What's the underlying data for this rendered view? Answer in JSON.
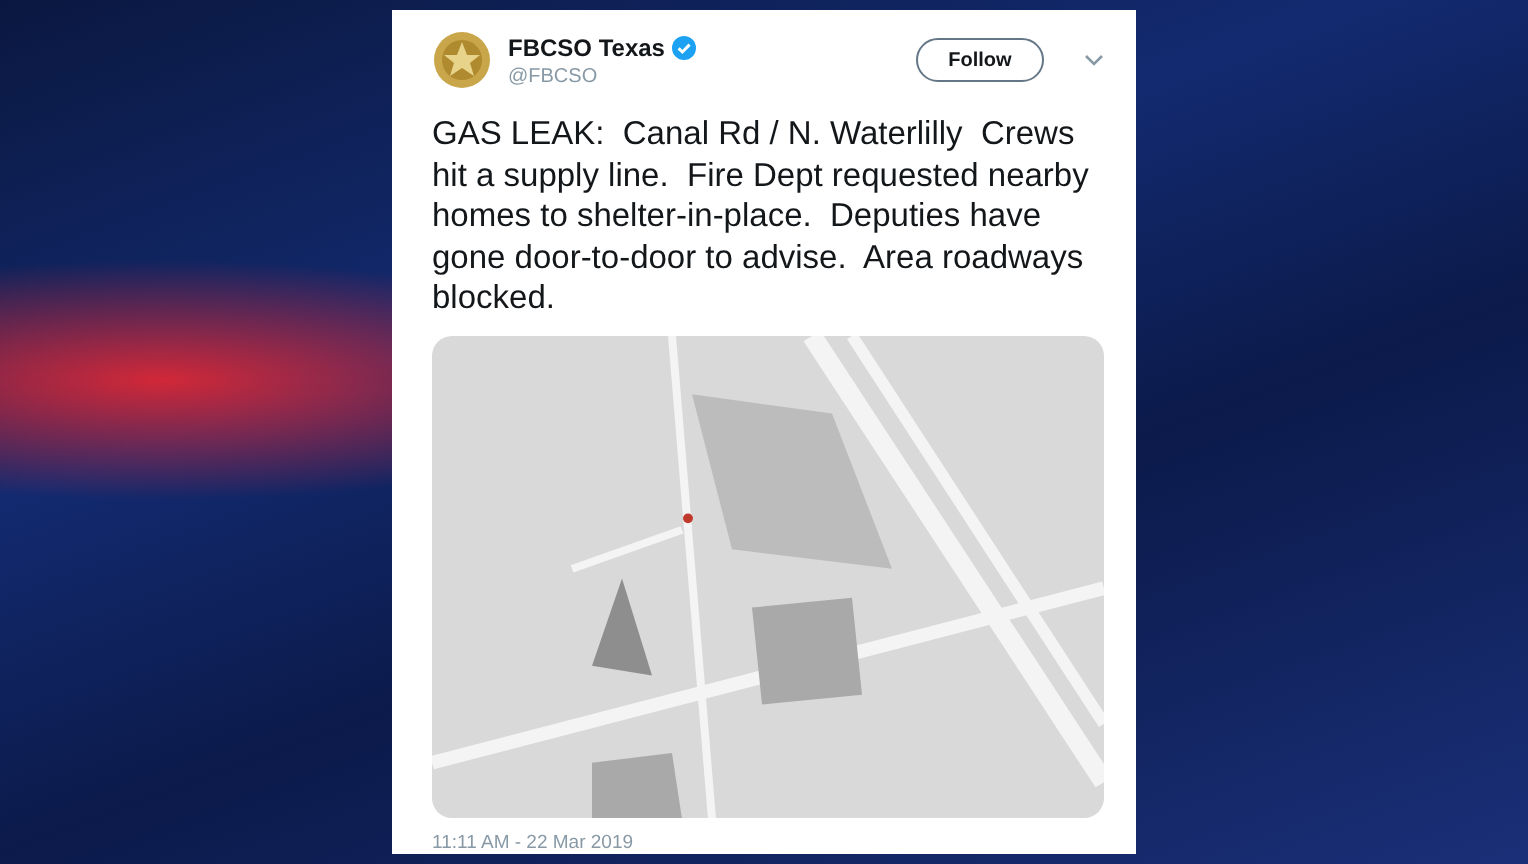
{
  "tweet": {
    "author": "FBCSO Texas",
    "verified": true,
    "handle": "@FBCSO",
    "follow_button": "Follow",
    "text": "GAS LEAK:  Canal Rd / N. Waterlilly  Crews hit a supply line.  Fire Dept requested nearby homes to shelter-in-place.  Deputies have gone door-to-door to advise.  Area roadways blocked.",
    "timestamp": "11:11 AM - 22 Mar 2019"
  }
}
